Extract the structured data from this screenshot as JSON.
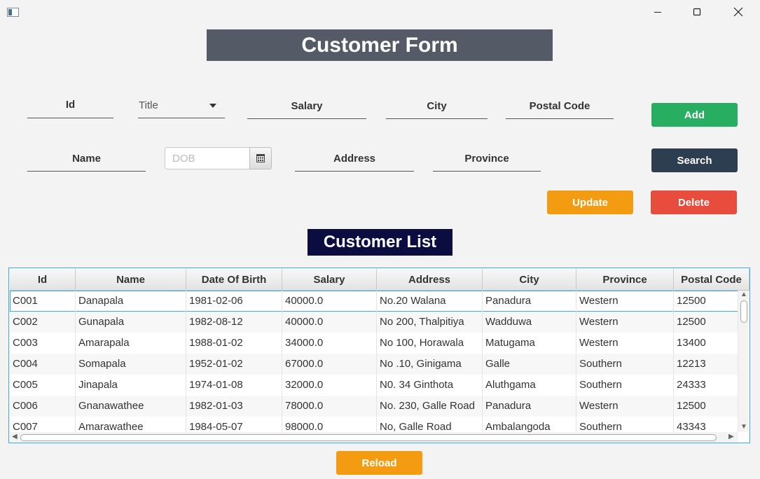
{
  "window": {
    "icon": "app-window-icon",
    "controls": [
      "minimize-icon",
      "maximize-icon",
      "close-icon"
    ]
  },
  "form": {
    "title": "Customer Form",
    "fields": {
      "id": "Id",
      "title": "Title",
      "salary": "Salary",
      "city": "City",
      "postal_code": "Postal Code",
      "name": "Name",
      "dob_placeholder": "DOB",
      "address": "Address",
      "province": "Province"
    },
    "buttons": {
      "add": "Add",
      "search": "Search",
      "update": "Update",
      "delete": "Delete"
    }
  },
  "list": {
    "title": "Customer List",
    "columns": [
      "Id",
      "Name",
      "Date Of Birth",
      "Salary",
      "Address",
      "City",
      "Province",
      "Postal Code"
    ],
    "rows": [
      [
        "C001",
        "Danapala",
        "1981-02-06",
        "40000.0",
        "No.20 Walana",
        "Panadura",
        "Western",
        "12500"
      ],
      [
        "C002",
        "Gunapala",
        "1982-08-12",
        "40000.0",
        "No 200, Thalpitiya",
        "Wadduwa",
        "Western",
        "12500"
      ],
      [
        "C003",
        "Amarapala",
        "1988-01-02",
        "34000.0",
        "No 100, Horawala",
        "Matugama",
        "Western",
        "13400"
      ],
      [
        "C004",
        "Somapala",
        "1952-01-02",
        "67000.0",
        "No .10, Ginigama",
        "Galle",
        "Southern",
        "12213"
      ],
      [
        "C005",
        "Jinapala",
        "1974-01-08",
        "32000.0",
        "N0. 34 Ginthota",
        "Aluthgama",
        "Southern",
        "24333"
      ],
      [
        "C006",
        "Gnanawathee",
        "1982-01-03",
        "78000.0",
        "No. 230, Galle Road",
        "Panadura",
        "Western",
        "12500"
      ],
      [
        "C007",
        "Amarawathee",
        "1984-05-07",
        "98000.0",
        "No, Galle Road",
        "Ambalangoda",
        "Southern",
        "43343"
      ]
    ],
    "selected_row": 0,
    "reload_label": "Reload"
  },
  "colors": {
    "add": "#27ae60",
    "search": "#2c3e50",
    "update": "#f39c12",
    "delete": "#e74c3c",
    "reload": "#f39c12",
    "form_heading": "#545b66",
    "list_heading": "#0b0d40",
    "table_focus": "#3fa9e0"
  }
}
